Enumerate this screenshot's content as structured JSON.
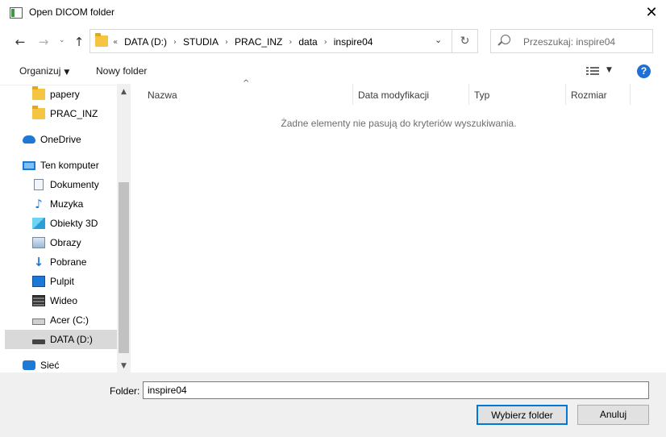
{
  "window": {
    "title": "Open DICOM folder",
    "close_glyph": "✕"
  },
  "nav": {
    "back": "←",
    "forward": "→",
    "recent": "⌄",
    "up": "↑"
  },
  "address": {
    "overflow": "«",
    "crumbs": [
      "DATA (D:)",
      "STUDIA",
      "PRAC_INZ",
      "data",
      "inspire04"
    ],
    "separator": "›",
    "dropdown": "⌄",
    "refresh": "↻"
  },
  "search": {
    "placeholder": "Przeszukaj: inspire04"
  },
  "toolbar": {
    "organize": "Organizuj",
    "new_folder": "Nowy folder",
    "caret": "▼",
    "help": "?"
  },
  "sidebar": {
    "items": [
      {
        "label": "papery",
        "icon": "folder-icon",
        "cls": "ic-folder"
      },
      {
        "label": "PRAC_INZ",
        "icon": "folder-icon",
        "cls": "ic-folder"
      },
      {
        "label": "OneDrive",
        "icon": "onedrive-cloud-icon",
        "cls": "ic-cloud"
      },
      {
        "label": "Ten komputer",
        "icon": "this-pc-icon",
        "cls": "ic-pc"
      },
      {
        "label": "Dokumenty",
        "icon": "documents-icon",
        "cls": "ic-doc"
      },
      {
        "label": "Muzyka",
        "icon": "music-note-icon",
        "cls": "ic-music",
        "glyph": "♪"
      },
      {
        "label": "Obiekty 3D",
        "icon": "objects-3d-icon",
        "cls": "ic-3d"
      },
      {
        "label": "Obrazy",
        "icon": "pictures-icon",
        "cls": "ic-img"
      },
      {
        "label": "Pobrane",
        "icon": "downloads-arrow-icon",
        "cls": "ic-down",
        "glyph": "↓"
      },
      {
        "label": "Pulpit",
        "icon": "desktop-icon",
        "cls": "ic-desk"
      },
      {
        "label": "Wideo",
        "icon": "video-film-icon",
        "cls": "ic-video"
      },
      {
        "label": "Acer (C:)",
        "icon": "system-drive-icon",
        "cls": "ic-drive"
      },
      {
        "label": "DATA (D:)",
        "icon": "data-drive-icon",
        "cls": "ic-drive2",
        "selected": true
      },
      {
        "label": "Sieć",
        "icon": "network-icon",
        "cls": "ic-net"
      }
    ],
    "scroll_up": "▲",
    "scroll_down": "▼"
  },
  "content": {
    "sort_indicator": "^",
    "columns": [
      "Nazwa",
      "Data modyfikacji",
      "Typ",
      "Rozmiar"
    ],
    "empty_message": "Żadne elementy nie pasują do kryteriów wyszukiwania."
  },
  "footer": {
    "folder_label": "Folder:",
    "folder_value": "inspire04",
    "select_button": "Wybierz folder",
    "cancel_button": "Anuluj"
  }
}
